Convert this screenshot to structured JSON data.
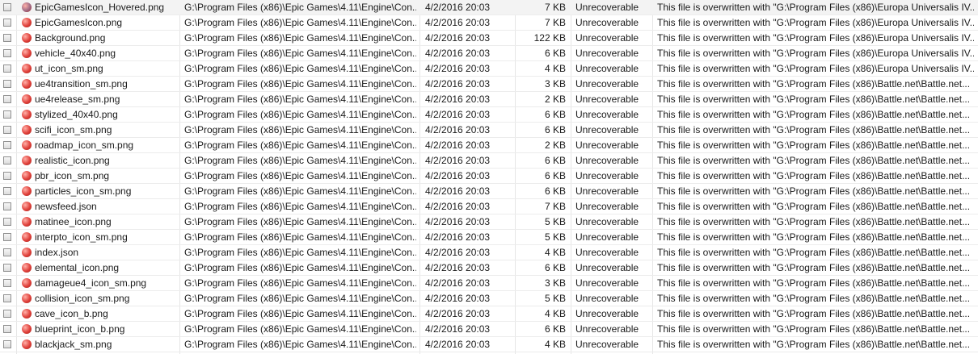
{
  "colors": {
    "dot_red": "#e0403a",
    "dot_hovered": "#a06b86"
  },
  "rows": [
    {
      "name": "EpicGamesIcon_Hovered.png",
      "path": "G:\\Program Files (x86)\\Epic Games\\4.11\\Engine\\Con...",
      "date": "4/2/2016 20:03",
      "size": "7 KB",
      "state": "Unrecoverable",
      "comment": "This file is overwritten with \"G:\\Program Files (x86)\\Europa Universalis IV..."
    },
    {
      "name": "EpicGamesIcon.png",
      "path": "G:\\Program Files (x86)\\Epic Games\\4.11\\Engine\\Con...",
      "date": "4/2/2016 20:03",
      "size": "7 KB",
      "state": "Unrecoverable",
      "comment": "This file is overwritten with \"G:\\Program Files (x86)\\Europa Universalis IV..."
    },
    {
      "name": "Background.png",
      "path": "G:\\Program Files (x86)\\Epic Games\\4.11\\Engine\\Con...",
      "date": "4/2/2016 20:03",
      "size": "122 KB",
      "state": "Unrecoverable",
      "comment": "This file is overwritten with \"G:\\Program Files (x86)\\Europa Universalis IV..."
    },
    {
      "name": "vehicle_40x40.png",
      "path": "G:\\Program Files (x86)\\Epic Games\\4.11\\Engine\\Con...",
      "date": "4/2/2016 20:03",
      "size": "6 KB",
      "state": "Unrecoverable",
      "comment": "This file is overwritten with \"G:\\Program Files (x86)\\Europa Universalis IV..."
    },
    {
      "name": "ut_icon_sm.png",
      "path": "G:\\Program Files (x86)\\Epic Games\\4.11\\Engine\\Con...",
      "date": "4/2/2016 20:03",
      "size": "4 KB",
      "state": "Unrecoverable",
      "comment": "This file is overwritten with \"G:\\Program Files (x86)\\Europa Universalis IV..."
    },
    {
      "name": "ue4transition_sm.png",
      "path": "G:\\Program Files (x86)\\Epic Games\\4.11\\Engine\\Con...",
      "date": "4/2/2016 20:03",
      "size": "3 KB",
      "state": "Unrecoverable",
      "comment": "This file is overwritten with \"G:\\Program Files (x86)\\Battle.net\\Battle.net..."
    },
    {
      "name": "ue4release_sm.png",
      "path": "G:\\Program Files (x86)\\Epic Games\\4.11\\Engine\\Con...",
      "date": "4/2/2016 20:03",
      "size": "2 KB",
      "state": "Unrecoverable",
      "comment": "This file is overwritten with \"G:\\Program Files (x86)\\Battle.net\\Battle.net..."
    },
    {
      "name": "stylized_40x40.png",
      "path": "G:\\Program Files (x86)\\Epic Games\\4.11\\Engine\\Con...",
      "date": "4/2/2016 20:03",
      "size": "6 KB",
      "state": "Unrecoverable",
      "comment": "This file is overwritten with \"G:\\Program Files (x86)\\Battle.net\\Battle.net..."
    },
    {
      "name": "scifi_icon_sm.png",
      "path": "G:\\Program Files (x86)\\Epic Games\\4.11\\Engine\\Con...",
      "date": "4/2/2016 20:03",
      "size": "6 KB",
      "state": "Unrecoverable",
      "comment": "This file is overwritten with \"G:\\Program Files (x86)\\Battle.net\\Battle.net..."
    },
    {
      "name": "roadmap_icon_sm.png",
      "path": "G:\\Program Files (x86)\\Epic Games\\4.11\\Engine\\Con...",
      "date": "4/2/2016 20:03",
      "size": "2 KB",
      "state": "Unrecoverable",
      "comment": "This file is overwritten with \"G:\\Program Files (x86)\\Battle.net\\Battle.net..."
    },
    {
      "name": "realistic_icon.png",
      "path": "G:\\Program Files (x86)\\Epic Games\\4.11\\Engine\\Con...",
      "date": "4/2/2016 20:03",
      "size": "6 KB",
      "state": "Unrecoverable",
      "comment": "This file is overwritten with \"G:\\Program Files (x86)\\Battle.net\\Battle.net..."
    },
    {
      "name": "pbr_icon_sm.png",
      "path": "G:\\Program Files (x86)\\Epic Games\\4.11\\Engine\\Con...",
      "date": "4/2/2016 20:03",
      "size": "6 KB",
      "state": "Unrecoverable",
      "comment": "This file is overwritten with \"G:\\Program Files (x86)\\Battle.net\\Battle.net..."
    },
    {
      "name": "particles_icon_sm.png",
      "path": "G:\\Program Files (x86)\\Epic Games\\4.11\\Engine\\Con...",
      "date": "4/2/2016 20:03",
      "size": "6 KB",
      "state": "Unrecoverable",
      "comment": "This file is overwritten with \"G:\\Program Files (x86)\\Battle.net\\Battle.net..."
    },
    {
      "name": "newsfeed.json",
      "path": "G:\\Program Files (x86)\\Epic Games\\4.11\\Engine\\Con...",
      "date": "4/2/2016 20:03",
      "size": "7 KB",
      "state": "Unrecoverable",
      "comment": "This file is overwritten with \"G:\\Program Files (x86)\\Battle.net\\Battle.net..."
    },
    {
      "name": "matinee_icon.png",
      "path": "G:\\Program Files (x86)\\Epic Games\\4.11\\Engine\\Con...",
      "date": "4/2/2016 20:03",
      "size": "5 KB",
      "state": "Unrecoverable",
      "comment": "This file is overwritten with \"G:\\Program Files (x86)\\Battle.net\\Battle.net..."
    },
    {
      "name": "interpto_icon_sm.png",
      "path": "G:\\Program Files (x86)\\Epic Games\\4.11\\Engine\\Con...",
      "date": "4/2/2016 20:03",
      "size": "5 KB",
      "state": "Unrecoverable",
      "comment": "This file is overwritten with \"G:\\Program Files (x86)\\Battle.net\\Battle.net..."
    },
    {
      "name": "index.json",
      "path": "G:\\Program Files (x86)\\Epic Games\\4.11\\Engine\\Con...",
      "date": "4/2/2016 20:03",
      "size": "4 KB",
      "state": "Unrecoverable",
      "comment": "This file is overwritten with \"G:\\Program Files (x86)\\Battle.net\\Battle.net..."
    },
    {
      "name": "elemental_icon.png",
      "path": "G:\\Program Files (x86)\\Epic Games\\4.11\\Engine\\Con...",
      "date": "4/2/2016 20:03",
      "size": "6 KB",
      "state": "Unrecoverable",
      "comment": "This file is overwritten with \"G:\\Program Files (x86)\\Battle.net\\Battle.net..."
    },
    {
      "name": "damageue4_icon_sm.png",
      "path": "G:\\Program Files (x86)\\Epic Games\\4.11\\Engine\\Con...",
      "date": "4/2/2016 20:03",
      "size": "3 KB",
      "state": "Unrecoverable",
      "comment": "This file is overwritten with \"G:\\Program Files (x86)\\Battle.net\\Battle.net..."
    },
    {
      "name": "collision_icon_sm.png",
      "path": "G:\\Program Files (x86)\\Epic Games\\4.11\\Engine\\Con...",
      "date": "4/2/2016 20:03",
      "size": "5 KB",
      "state": "Unrecoverable",
      "comment": "This file is overwritten with \"G:\\Program Files (x86)\\Battle.net\\Battle.net..."
    },
    {
      "name": "cave_icon_b.png",
      "path": "G:\\Program Files (x86)\\Epic Games\\4.11\\Engine\\Con...",
      "date": "4/2/2016 20:03",
      "size": "4 KB",
      "state": "Unrecoverable",
      "comment": "This file is overwritten with \"G:\\Program Files (x86)\\Battle.net\\Battle.net..."
    },
    {
      "name": "blueprint_icon_b.png",
      "path": "G:\\Program Files (x86)\\Epic Games\\4.11\\Engine\\Con...",
      "date": "4/2/2016 20:03",
      "size": "6 KB",
      "state": "Unrecoverable",
      "comment": "This file is overwritten with \"G:\\Program Files (x86)\\Battle.net\\Battle.net..."
    },
    {
      "name": "blackjack_sm.png",
      "path": "G:\\Program Files (x86)\\Epic Games\\4.11\\Engine\\Con...",
      "date": "4/2/2016 20:03",
      "size": "4 KB",
      "state": "Unrecoverable",
      "comment": "This file is overwritten with \"G:\\Program Files (x86)\\Battle.net\\Battle.net..."
    }
  ]
}
